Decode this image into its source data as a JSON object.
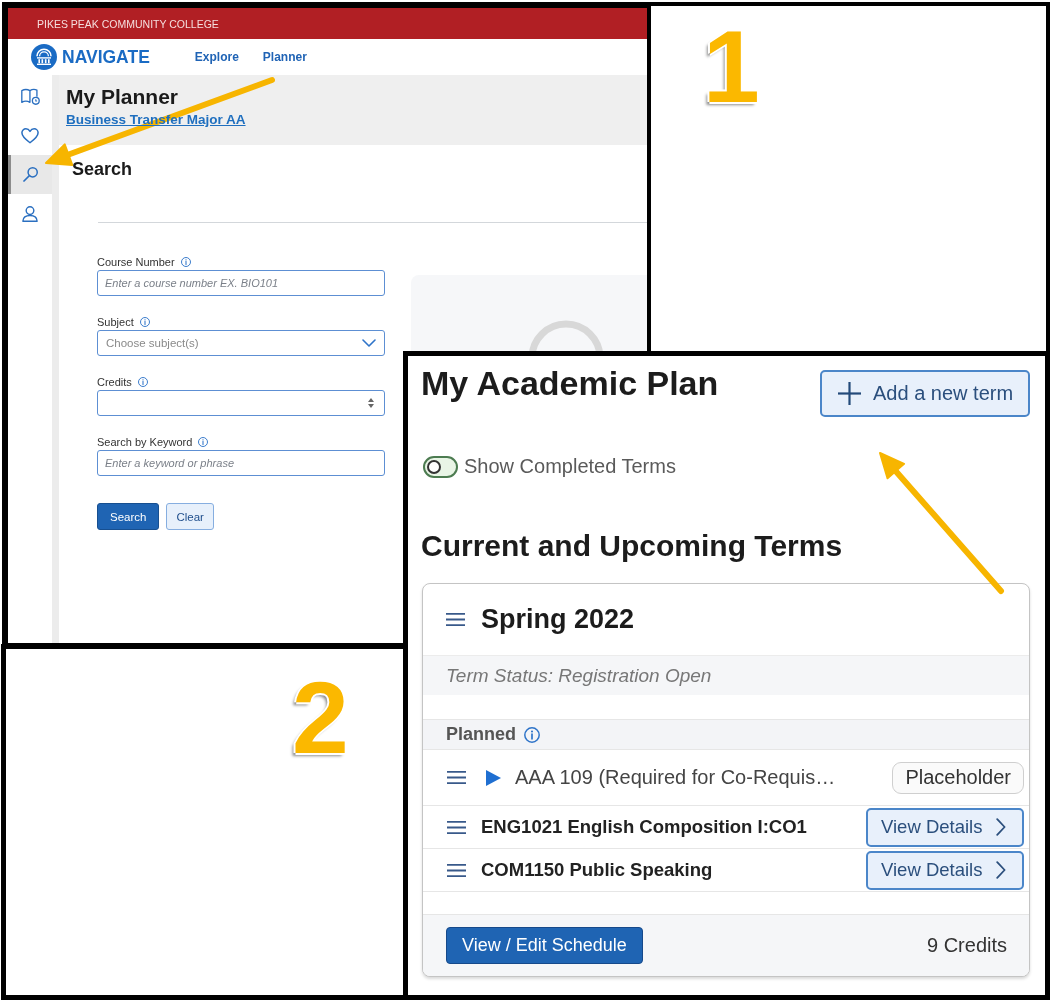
{
  "screenshot_1": {
    "banner": "PIKES PEAK COMMUNITY COLLEGE",
    "logo_text": "NAVIGATE",
    "nav_links": [
      "Explore",
      "Planner"
    ],
    "sidebar": {
      "items": [
        {
          "selected": false
        },
        {
          "selected": false
        },
        {
          "selected": true
        },
        {
          "selected": false
        }
      ]
    },
    "page_header": {
      "title": "My Planner",
      "program_link": "Business Transfer Major AA"
    },
    "search": {
      "title": "Search",
      "fields": [
        {
          "kind": "text",
          "label": "Course Number",
          "placeholder": "Enter a course number EX. BIO101"
        },
        {
          "kind": "select",
          "label": "Subject",
          "placeholder": "Choose subject(s)"
        },
        {
          "kind": "number",
          "label": "Credits"
        },
        {
          "kind": "text",
          "label": "Search by Keyword",
          "placeholder": "Enter a keyword or phrase"
        }
      ],
      "buttons": [
        {
          "kind": "primary",
          "label": "Search"
        },
        {
          "kind": "secondary",
          "label": "Clear"
        }
      ]
    }
  },
  "step_labels": [
    "1",
    "2"
  ],
  "screenshot_2": {
    "title": "My Academic Plan",
    "add_term_button": "Add a new term",
    "show_completed": {
      "label": "Show Completed Terms",
      "on": false
    },
    "section_title": "Current and Upcoming Terms",
    "term": {
      "name": "Spring 2022",
      "status": "Term Status: Registration Open",
      "group_label": "Planned",
      "courses": [
        {
          "kind": "placeholder",
          "title": "AAA 109 (Required for Co-Requis…",
          "badge": "Placeholder"
        },
        {
          "kind": "course",
          "title": "ENG1021 English Composition I:CO1",
          "action": "View Details"
        },
        {
          "kind": "course",
          "title": "COM1150 Public Speaking",
          "action": "View Details"
        }
      ],
      "schedule_button": "View / Edit Schedule",
      "credits": "9 Credits"
    }
  }
}
